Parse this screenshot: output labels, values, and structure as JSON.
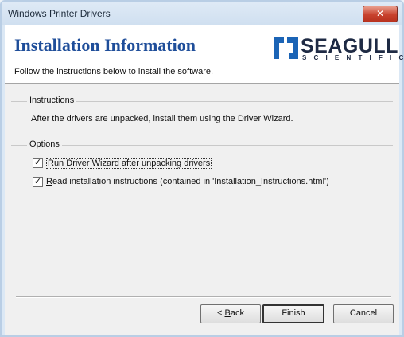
{
  "window": {
    "title": "Windows Printer Drivers",
    "close_label": "✕"
  },
  "header": {
    "title": "Installation Information",
    "subtitle": "Follow the instructions below to install the software.",
    "logo": {
      "word": "SEAGULL",
      "sub": "SCIENTIFIC"
    }
  },
  "instructions": {
    "label": "Instructions",
    "text": "After the drivers are unpacked, install them using the Driver Wizard."
  },
  "options": {
    "label": "Options",
    "items": [
      {
        "pre": "Run ",
        "key": "D",
        "post": "river Wizard after unpacking drivers",
        "checked": true
      },
      {
        "pre": "",
        "key": "R",
        "post": "ead installation instructions (contained in 'Installation_Instructions.html')",
        "checked": true
      }
    ]
  },
  "buttons": {
    "back_pre": "< ",
    "back_key": "B",
    "back_post": "ack",
    "finish": "Finish",
    "cancel": "Cancel"
  },
  "colors": {
    "heading": "#1f4e9a",
    "logo_mark": "#1b64b6",
    "close": "#c8422e"
  }
}
